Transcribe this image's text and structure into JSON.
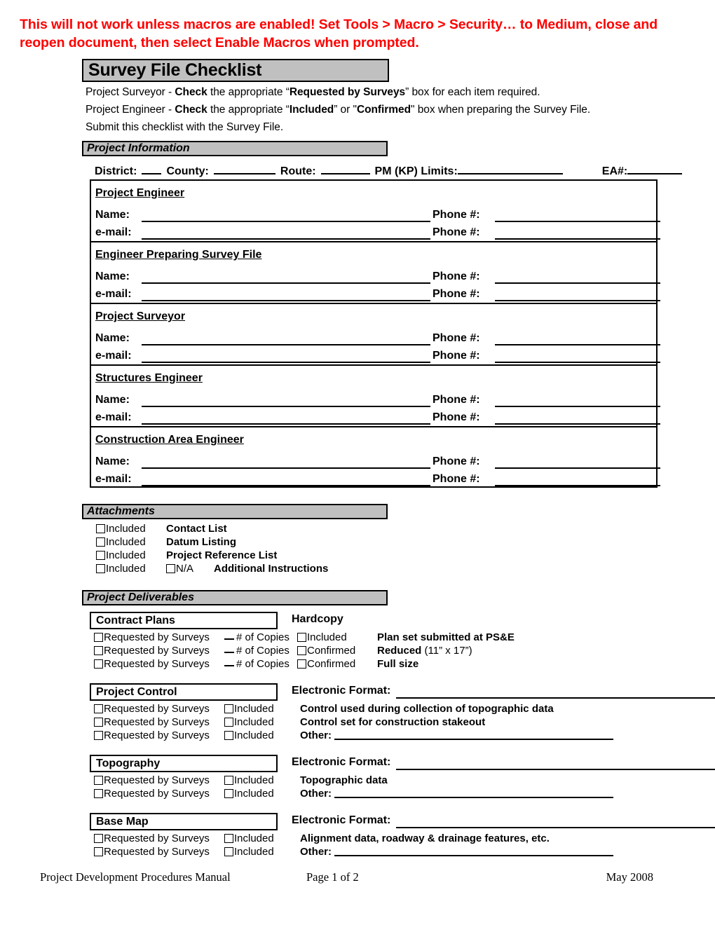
{
  "macro_warning": "This will not work unless macros are enabled! Set Tools > Macro > Security… to Medium, close and reopen document, then select Enable Macros when prompted.",
  "title": "Survey File Checklist",
  "intro": {
    "line1_a": "Project Surveyor - ",
    "line1_b": "Check",
    "line1_c": " the appropriate “",
    "line1_d": "Requested by Surveys",
    "line1_e": "” box for each item required.",
    "line2_a": "Project Engineer - ",
    "line2_b": "Check",
    "line2_c": " the appropriate “",
    "line2_d": "Included",
    "line2_e": "” or \"",
    "line2_f": "Confirmed",
    "line2_g": "\" box when preparing the Survey File.",
    "line3": "Submit this checklist with the Survey File."
  },
  "sections": {
    "project_information": "Project Information",
    "attachments": "Attachments",
    "project_deliverables": "Project Deliverables"
  },
  "district_line": {
    "district": "District:",
    "county": "County:",
    "route": "Route:",
    "pm_limits": "PM (KP) Limits:",
    "ea": "EA#:"
  },
  "contacts": {
    "name_label": "Name:",
    "email_label": "e-mail:",
    "phone_label": "Phone #:",
    "blocks": [
      {
        "heading": "Project Engineer"
      },
      {
        "heading": "Engineer Preparing Survey File"
      },
      {
        "heading": "Project Surveyor"
      },
      {
        "heading": "Structures Engineer"
      },
      {
        "heading": "Construction Area Engineer"
      }
    ]
  },
  "attachments_list": {
    "included_label": "Included",
    "na_label": "N/A",
    "items": [
      {
        "name": "Contact List",
        "has_na": false
      },
      {
        "name": "Datum Listing",
        "has_na": false
      },
      {
        "name": "Project Reference List",
        "has_na": false
      },
      {
        "name": "Additional Instructions",
        "has_na": true
      }
    ]
  },
  "deliverables": {
    "requested_label": "Requested by Surveys",
    "copies_label": "# of Copies",
    "included_label": "Included",
    "confirmed_label": "Confirmed",
    "other_label": "Other:",
    "electronic_format_label": "Electronic Format:",
    "groups": [
      {
        "title": "Contract Plans",
        "right_label": "Hardcopy",
        "has_format_line": false,
        "rows": [
          {
            "copies": true,
            "mid": "Included",
            "desc": "Plan set submitted at PS&E",
            "desc_suffix": "",
            "other": false
          },
          {
            "copies": true,
            "mid": "Confirmed",
            "desc": "Reduced",
            "desc_suffix": " (11” x 17”)",
            "other": false
          },
          {
            "copies": true,
            "mid": "Confirmed",
            "desc": "Full size",
            "desc_suffix": "",
            "other": false
          }
        ]
      },
      {
        "title": "Project Control",
        "right_label": "Electronic Format:",
        "has_format_line": true,
        "rows": [
          {
            "copies": false,
            "mid": "Included",
            "desc": "Control used during collection of topographic data",
            "desc_suffix": "",
            "other": false
          },
          {
            "copies": false,
            "mid": "Included",
            "desc": "Control set for construction stakeout",
            "desc_suffix": "",
            "other": false
          },
          {
            "copies": false,
            "mid": "Included",
            "desc": "Other:",
            "desc_suffix": "",
            "other": true
          }
        ]
      },
      {
        "title": "Topography",
        "right_label": "Electronic Format:",
        "has_format_line": true,
        "rows": [
          {
            "copies": false,
            "mid": "Included",
            "desc": "Topographic data",
            "desc_suffix": "",
            "other": false
          },
          {
            "copies": false,
            "mid": "Included",
            "desc": "Other:",
            "desc_suffix": "",
            "other": true
          }
        ]
      },
      {
        "title": "Base Map",
        "right_label": "Electronic Format:",
        "has_format_line": true,
        "rows": [
          {
            "copies": false,
            "mid": "Included",
            "desc": "Alignment data, roadway & drainage features, etc.",
            "desc_suffix": "",
            "other": false
          },
          {
            "copies": false,
            "mid": "Included",
            "desc": "Other:",
            "desc_suffix": "",
            "other": true
          }
        ]
      }
    ]
  },
  "footer": {
    "left": "Project Development Procedures Manual",
    "middle": "Page 1 of 2",
    "right": "May 2008"
  }
}
